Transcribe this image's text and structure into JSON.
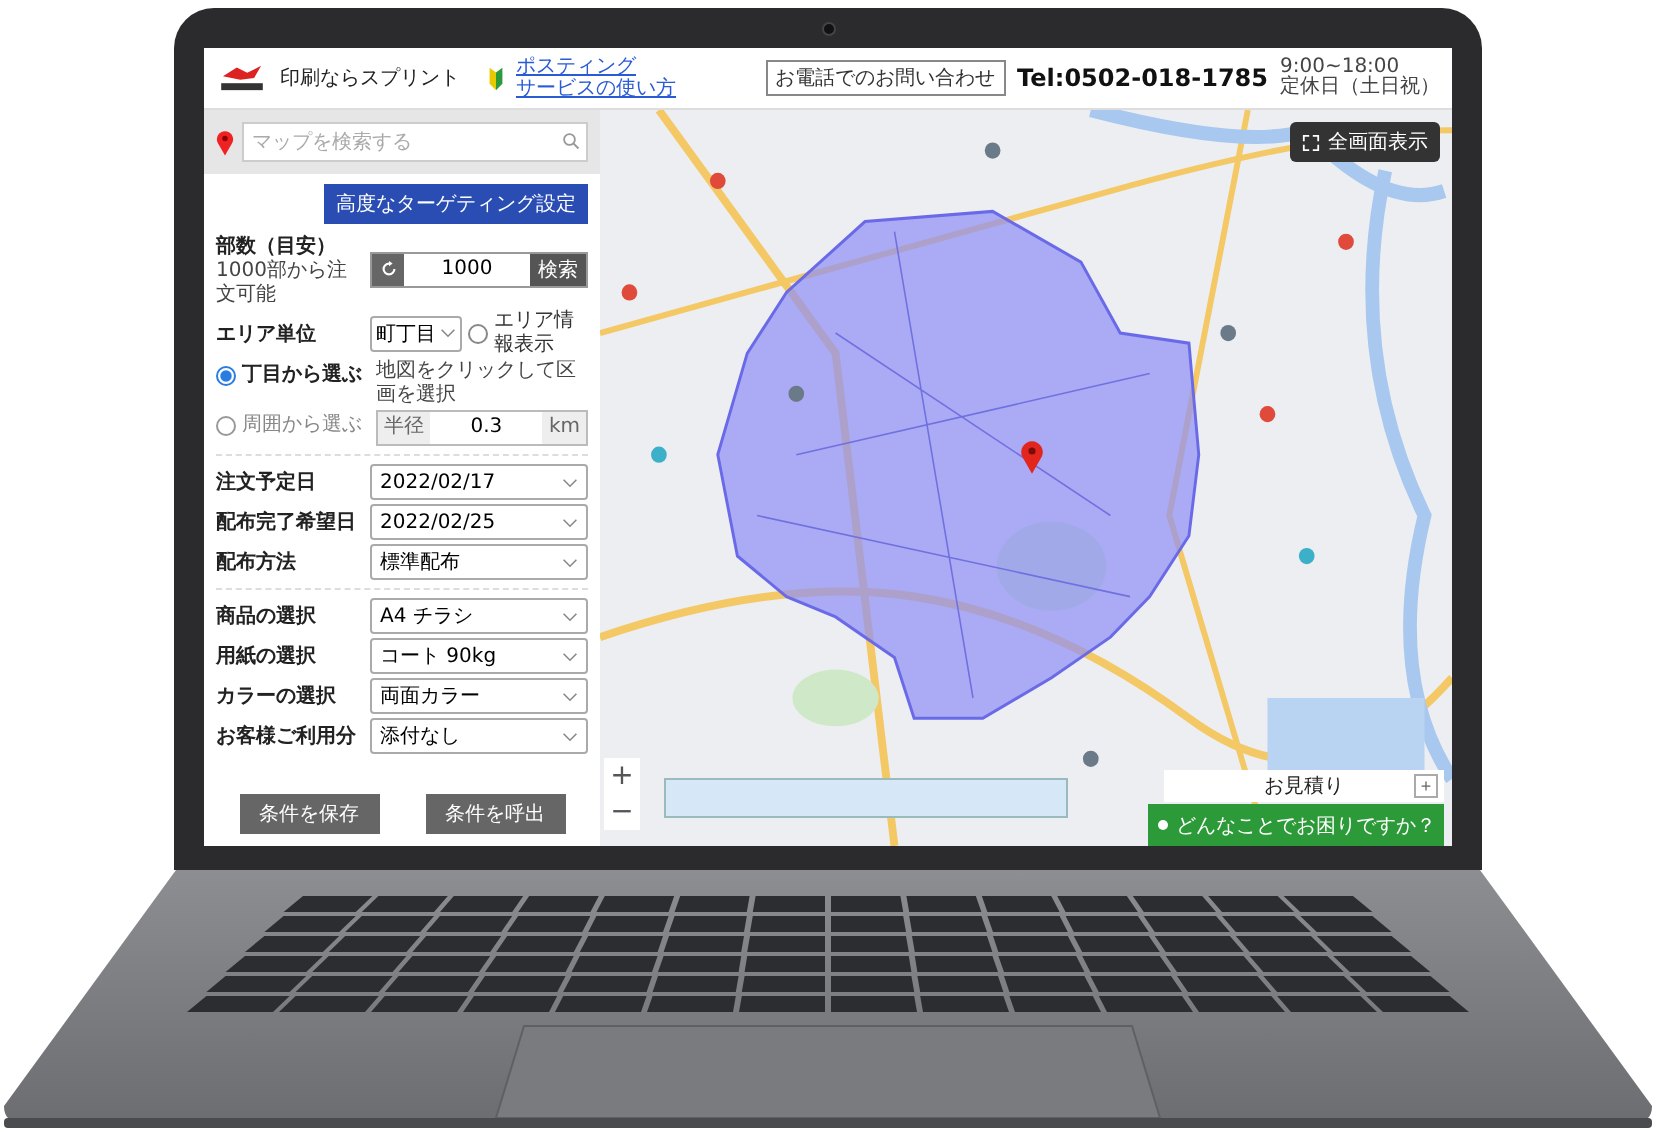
{
  "header": {
    "site_name": "印刷ならスプリント",
    "guide_link": [
      "ポスティング",
      "サービスの使い方"
    ],
    "contact_button": "お電話でのお問い合わせ",
    "tel": "Tel:0502-018-1785",
    "hours": [
      "9:00~18:00",
      "定休日（土日祝）"
    ]
  },
  "panel": {
    "search_placeholder": "マップを検索する",
    "targeting_button": "高度なターゲティング設定",
    "copies": {
      "label": "部数（目安）",
      "note": "1000部から注文可能",
      "value": "1000",
      "button": "検索"
    },
    "area_unit": {
      "label": "エリア単位",
      "value": "町丁目",
      "checkbox": {
        "label": "エリア情報表示",
        "checked": false
      }
    },
    "selection_modes": [
      {
        "kind": "click",
        "label": "丁目から選ぶ",
        "selected": true,
        "description": "地図をクリックして区画を選択"
      },
      {
        "kind": "radius",
        "label": "周囲から選ぶ",
        "selected": false,
        "prefix": "半径",
        "value": "0.3",
        "unit": "km"
      }
    ],
    "schedule": [
      {
        "label": "注文予定日",
        "value": "2022/02/17"
      },
      {
        "label": "配布完了希望日",
        "value": "2022/02/25"
      },
      {
        "label": "配布方法",
        "value": "標準配布"
      }
    ],
    "product": [
      {
        "label": "商品の選択",
        "value": "A4 チラシ"
      },
      {
        "label": "用紙の選択",
        "value": "コート 90kg"
      },
      {
        "label": "カラーの選択",
        "value": "両面カラー"
      },
      {
        "label": "お客様ご利用分",
        "value": "添付なし"
      }
    ],
    "buttons": [
      "条件を保存",
      "条件を呼出"
    ]
  },
  "map": {
    "fullscreen_button": "全画面表示",
    "zoom": [
      "+",
      "−"
    ],
    "estimate": {
      "title": "お見積り",
      "toggle": "+"
    },
    "chat": "どんなことでお困りですか？"
  }
}
